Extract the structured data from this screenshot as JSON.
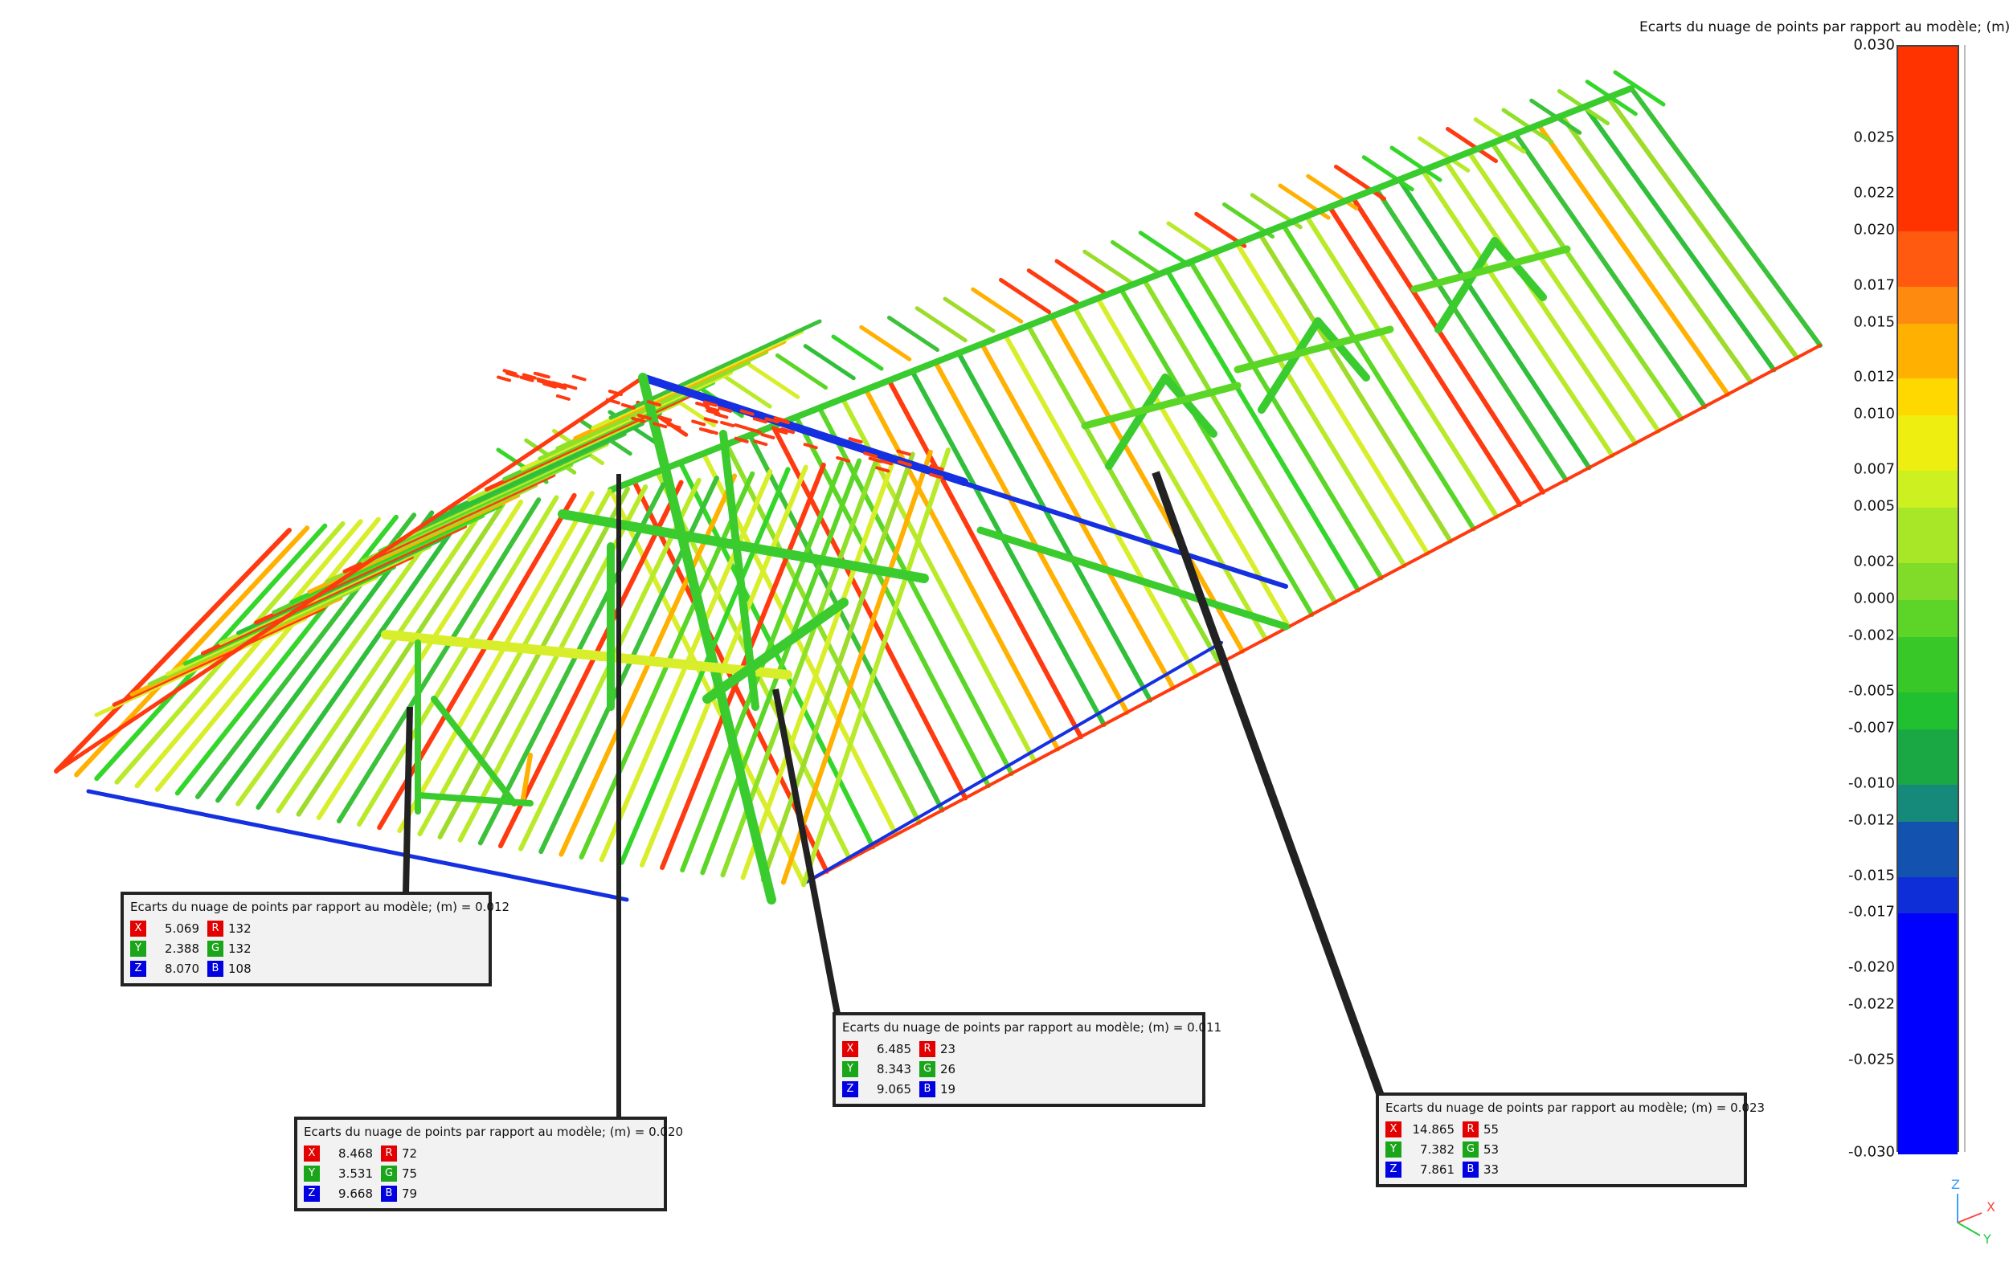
{
  "scale": {
    "title": "Ecarts du nuage de points par rapport au modèle; (m)",
    "ticks": [
      "0.030",
      "0.025",
      "0.022",
      "0.020",
      "0.017",
      "0.015",
      "0.012",
      "0.010",
      "0.007",
      "0.005",
      "0.002",
      "0.000",
      "-0.002",
      "-0.005",
      "-0.007",
      "-0.010",
      "-0.012",
      "-0.015",
      "-0.017",
      "-0.020",
      "-0.022",
      "-0.025",
      "-0.030"
    ],
    "colors": [
      "#ff3300",
      "#ff3300",
      "#ff3300",
      "#ff3300",
      "#ff5a10",
      "#ff8a10",
      "#ffb000",
      "#ffd800",
      "#eeee10",
      "#ccf020",
      "#a8e628",
      "#80dc28",
      "#5cd428",
      "#38c828",
      "#20c030",
      "#1aa844",
      "#168a7a",
      "#1452b0",
      "#0e2ed8",
      "#0000ff",
      "#0000ff",
      "#0000ff",
      "#0000ff"
    ]
  },
  "annotations": [
    {
      "title": "Ecarts du nuage de points par rapport au modèle; (m) = 0.012",
      "x": "5.069",
      "y": "2.388",
      "z": "8.070",
      "r": "132",
      "g": "132",
      "b": "108"
    },
    {
      "title": "Ecarts du nuage de points par rapport au modèle; (m) = 0.020",
      "x": "8.468",
      "y": "3.531",
      "z": "9.668",
      "r": "72",
      "g": "75",
      "b": "79"
    },
    {
      "title": "Ecarts du nuage de points par rapport au modèle; (m) = 0.011",
      "x": "6.485",
      "y": "8.343",
      "z": "9.065",
      "r": "23",
      "g": "26",
      "b": "19"
    },
    {
      "title": "Ecarts du nuage de points par rapport au modèle; (m) = 0.023",
      "x": "14.865",
      "y": "7.382",
      "z": "7.861",
      "r": "55",
      "g": "53",
      "b": "33"
    }
  ],
  "labels": {
    "x": "X",
    "y": "Y",
    "z": "Z",
    "r": "R",
    "g": "G",
    "b": "B"
  },
  "axis_triad": {
    "x": "X",
    "y": "Y",
    "z": "Z"
  }
}
